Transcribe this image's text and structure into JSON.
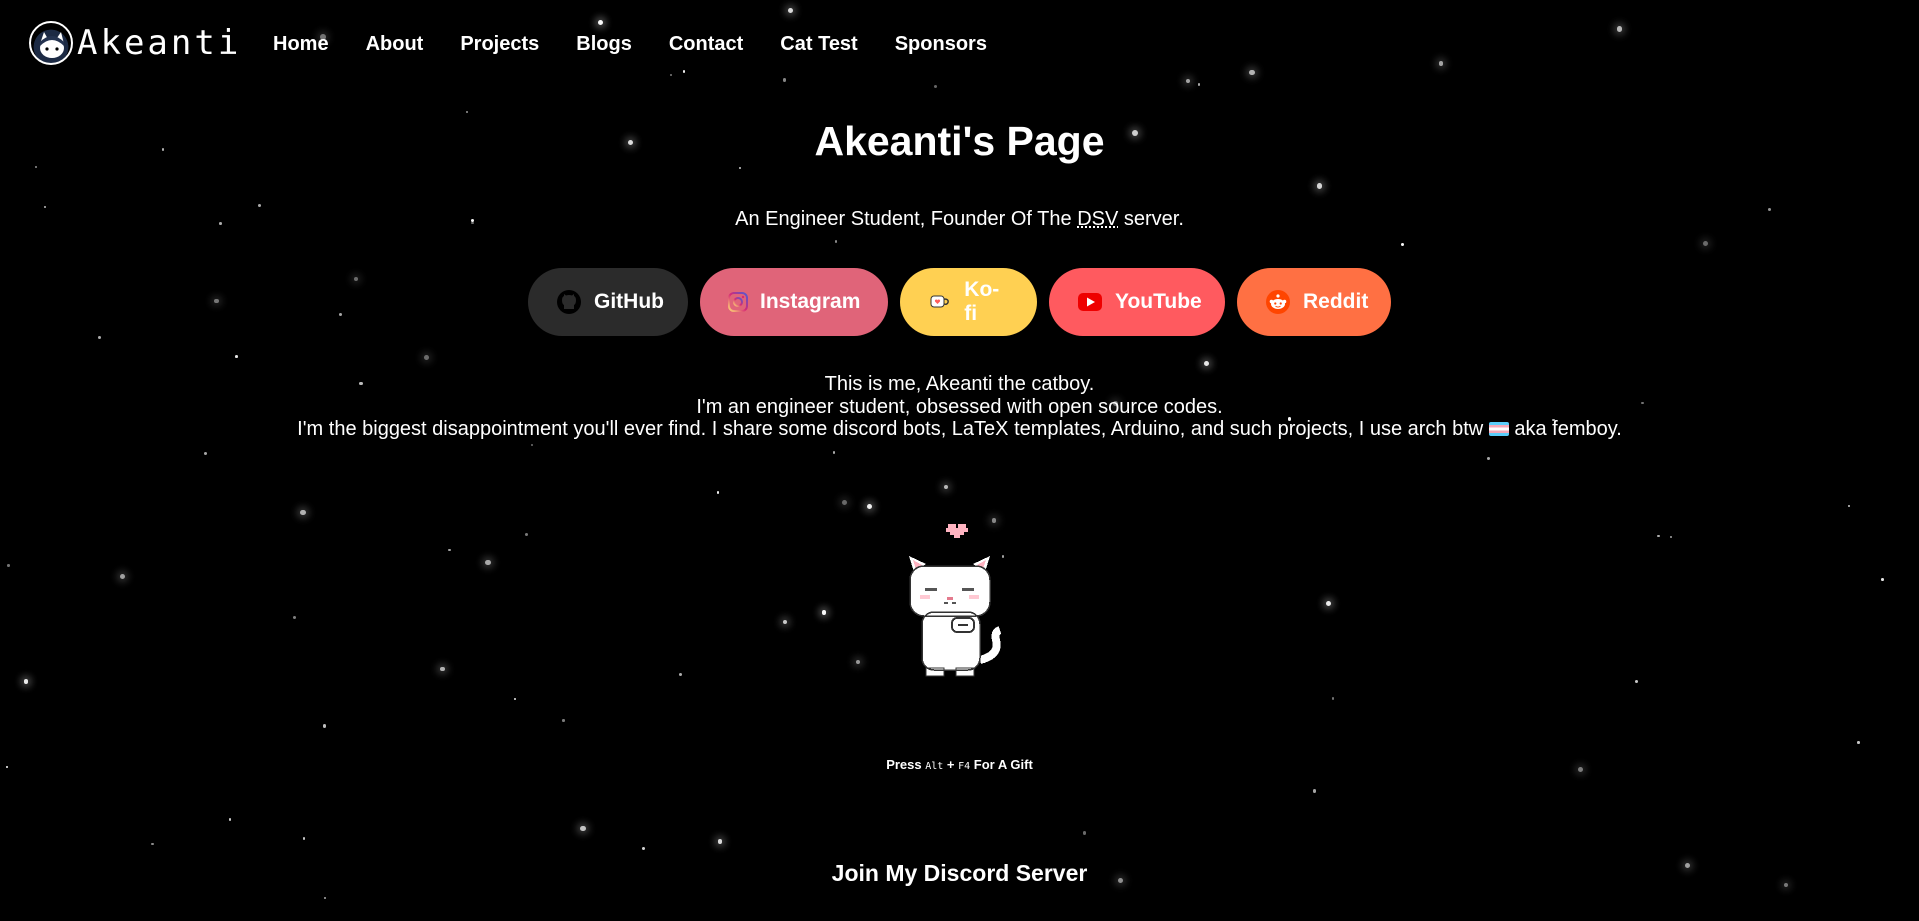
{
  "site": {
    "logo_text": "Akeanti"
  },
  "nav": {
    "items": [
      {
        "label": "Home"
      },
      {
        "label": "About"
      },
      {
        "label": "Projects"
      },
      {
        "label": "Blogs"
      },
      {
        "label": "Contact"
      },
      {
        "label": "Cat Test"
      },
      {
        "label": "Sponsors"
      }
    ]
  },
  "hero": {
    "title": "Akeanti's Page",
    "subtitle_before": "An Engineer Student, Founder Of The ",
    "subtitle_abbr": "DSV",
    "subtitle_after": " server."
  },
  "socials": [
    {
      "label": "GitHub",
      "icon": "github-icon",
      "color": "#2b2b2b"
    },
    {
      "label": "Instagram",
      "icon": "instagram-icon",
      "color": "#e06479"
    },
    {
      "label": "Ko-fi",
      "icon": "kofi-cup-icon",
      "color": "#ffd052"
    },
    {
      "label": "YouTube",
      "icon": "youtube-icon",
      "color": "#ff5a5f"
    },
    {
      "label": "Reddit",
      "icon": "reddit-icon",
      "color": "#ff7043"
    }
  ],
  "bio": {
    "line1": "This is me, Akeanti the catboy.",
    "line2": "I'm an engineer student, obsessed with open source codes.",
    "line3_before": "I'm the biggest disappointment you'll ever find. I share some discord bots, LaTeX templates, Arduino, and such projects, I use arch btw ",
    "line3_after": " aka femboy."
  },
  "gift": {
    "before": "Press ",
    "key1": "Alt",
    "plus": " + ",
    "key2": "F4",
    "after": " For A Gift"
  },
  "discord": {
    "heading": "Join My Discord Server"
  },
  "colors": {
    "background": "#000000",
    "text": "#ffffff"
  }
}
